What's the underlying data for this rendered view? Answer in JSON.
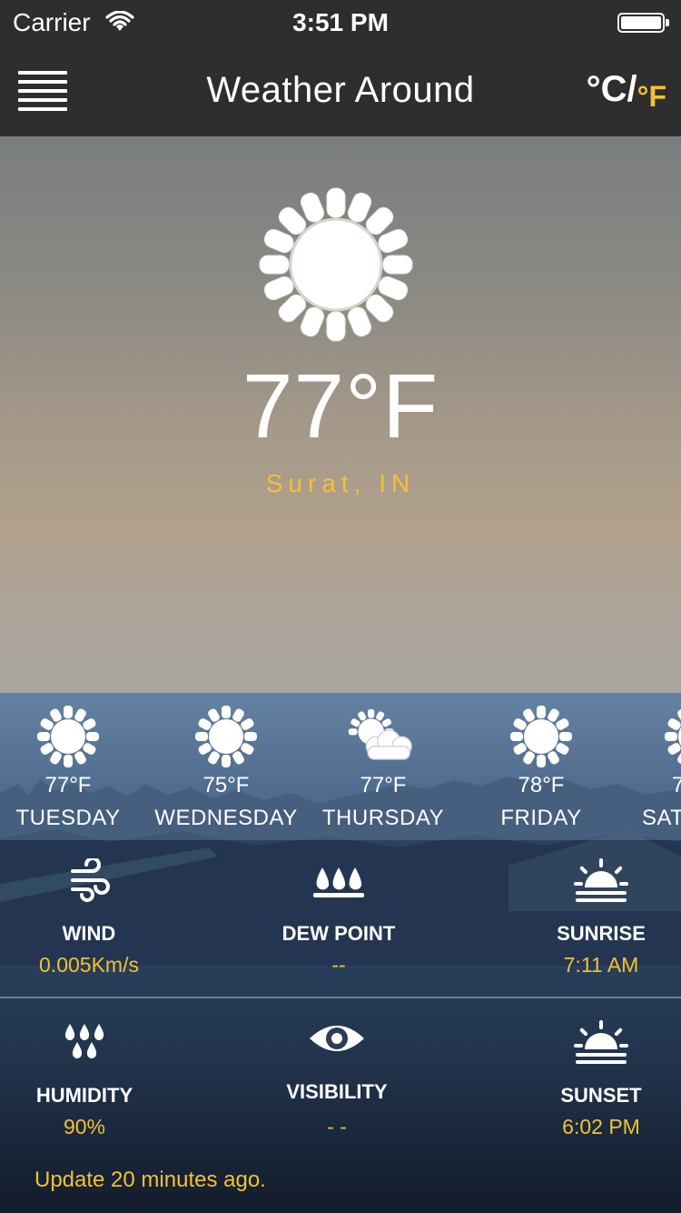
{
  "status_bar": {
    "carrier": "Carrier",
    "time": "3:51 PM"
  },
  "nav": {
    "title": "Weather Around",
    "unit_celsius": "°C",
    "unit_separator": "/",
    "unit_fahrenheit": "°F",
    "menu_icon": "hamburger-icon"
  },
  "current": {
    "icon": "sun-icon",
    "temperature": "77°F",
    "location": "Surat, IN"
  },
  "forecast": [
    {
      "day": "TUESDAY",
      "temp": "77°F",
      "icon": "sun-icon"
    },
    {
      "day": "WEDNESDAY",
      "temp": "75°F",
      "icon": "sun-icon"
    },
    {
      "day": "THURSDAY",
      "temp": "77°F",
      "icon": "partly-cloudy-icon"
    },
    {
      "day": "FRIDAY",
      "temp": "78°F",
      "icon": "sun-icon"
    },
    {
      "day": "SAT",
      "temp": "7",
      "icon": "sun-icon"
    }
  ],
  "details": {
    "wind": {
      "label": "WIND",
      "value": "0.005Km/s",
      "icon": "wind-icon"
    },
    "dew_point": {
      "label": "DEW POINT",
      "value": "--",
      "icon": "dew-drops-icon"
    },
    "sunrise": {
      "label": "SUNRISE",
      "value": "7:11 AM",
      "icon": "sunrise-icon"
    },
    "humidity": {
      "label": "HUMIDITY",
      "value": "90%",
      "icon": "humidity-icon"
    },
    "visibility": {
      "label": "VISIBILITY",
      "value": "- -",
      "icon": "eye-icon"
    },
    "sunset": {
      "label": "SUNSET",
      "value": "6:02 PM",
      "icon": "sunset-icon"
    }
  },
  "footer": {
    "update_text": "Update 20 minutes ago."
  },
  "colors": {
    "accent": "#f2c230",
    "bar_bg": "#2e2e2e"
  }
}
